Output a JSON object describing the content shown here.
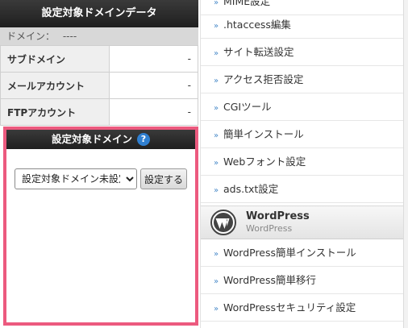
{
  "domain_data": {
    "header": "設定対象ドメインデータ",
    "domain_label": "ドメイン：",
    "domain_value": "----",
    "rows": [
      {
        "label": "サブドメイン",
        "value": "-"
      },
      {
        "label": "メールアカウント",
        "value": "-"
      },
      {
        "label": "FTPアカウント",
        "value": "-"
      }
    ]
  },
  "target_domain": {
    "header": "設定対象ドメイン",
    "help_icon": "question-circle-icon",
    "help_glyph": "?",
    "select": {
      "selected": "設定対象ドメイン未設定",
      "options": [
        "設定対象ドメイン未設定"
      ]
    },
    "set_button": "設定する",
    "border_color": "#ec5a7f"
  },
  "menu": {
    "cutoff_item": "MIME設定",
    "items": [
      {
        "label": ".htaccess編集"
      },
      {
        "label": "サイト転送設定"
      },
      {
        "label": "アクセス拒否設定"
      },
      {
        "label": "CGIツール"
      },
      {
        "label": "簡単インストール"
      },
      {
        "label": "Webフォント設定"
      },
      {
        "label": "ads.txt設定"
      }
    ],
    "wordpress_section": {
      "title": "WordPress",
      "subtitle": "WordPress",
      "icon": "wordpress-logo-icon"
    },
    "wordpress_items": [
      {
        "label": "WordPress簡単インストール"
      },
      {
        "label": "WordPress簡単移行"
      },
      {
        "label": "WordPressセキュリティ設定"
      }
    ],
    "arrow_icon": "double-chevron-right-icon",
    "arrow_glyph": "»"
  }
}
